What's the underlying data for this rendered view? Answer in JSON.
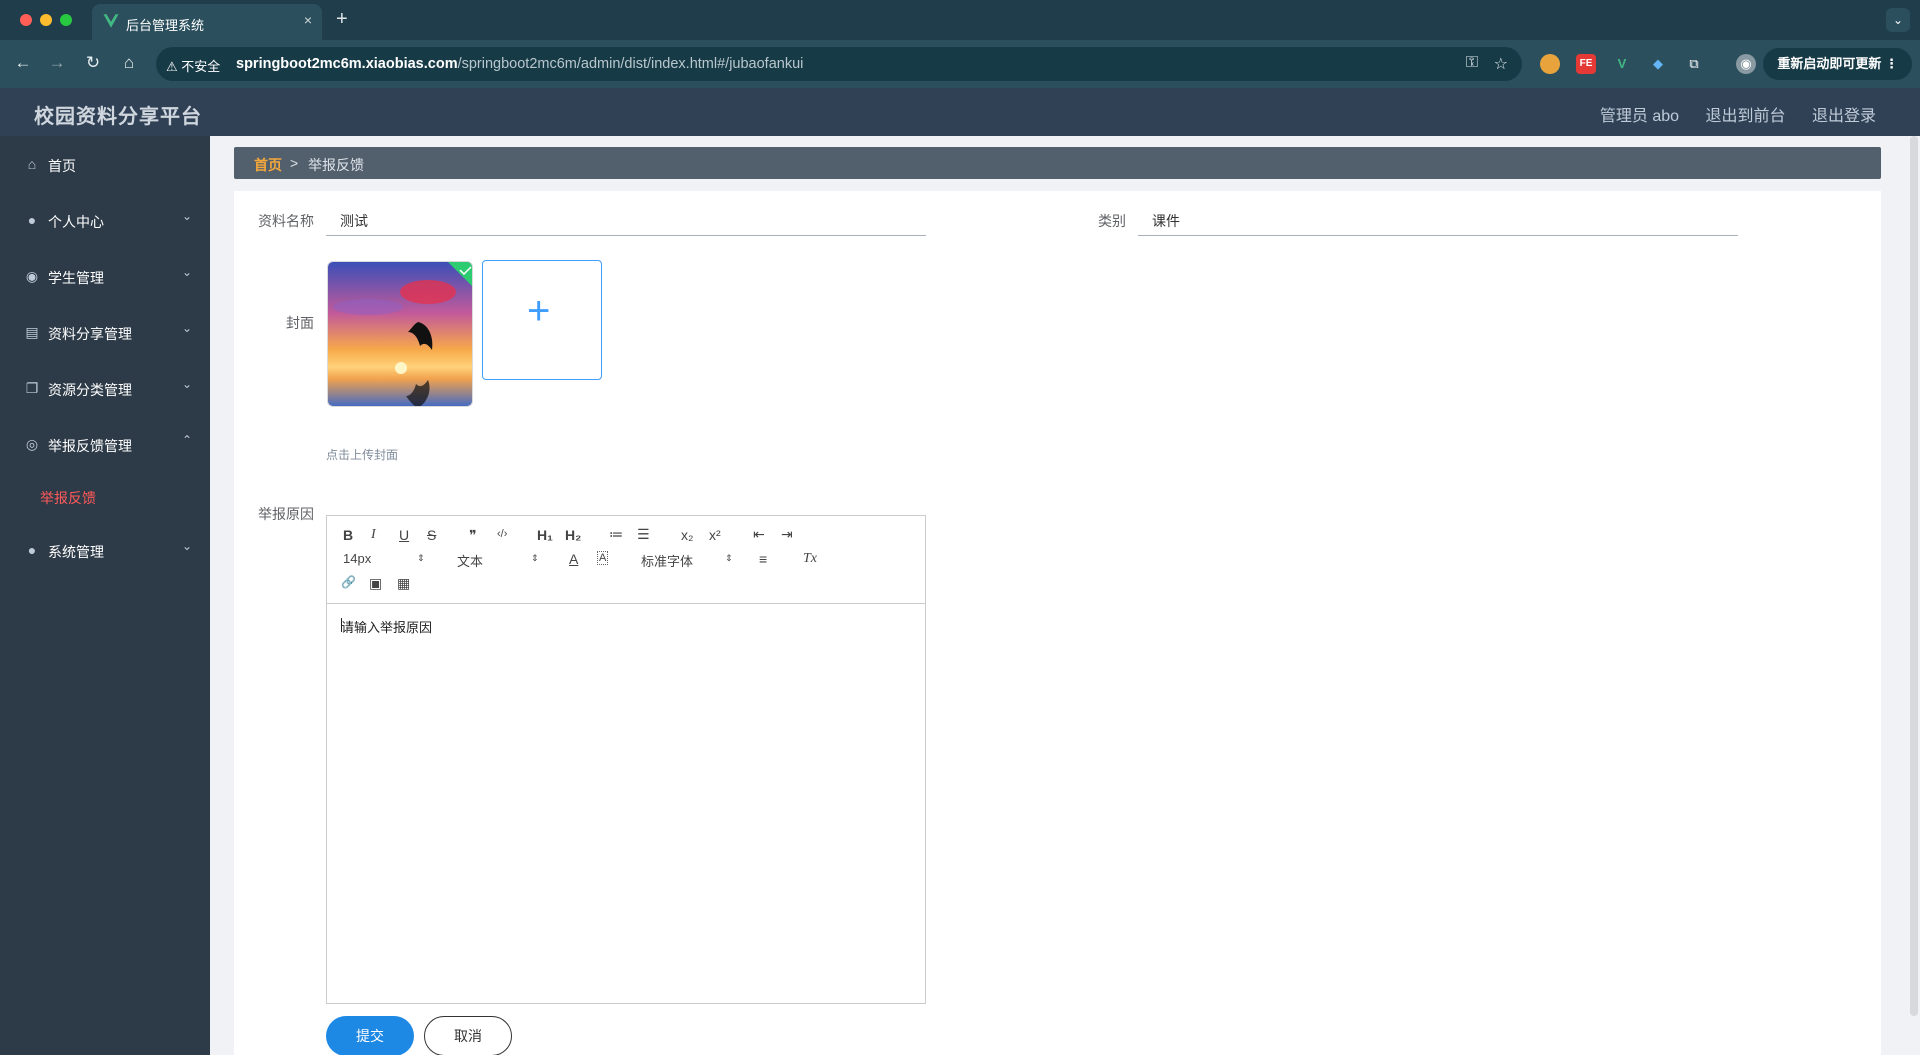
{
  "browser": {
    "tab_title": "后台管理系统",
    "close_glyph": "×",
    "new_tab_glyph": "+",
    "tab_menu_glyph": "⌄",
    "insecure_label": "⚠ 不安全",
    "url_host": "springboot2mc6m.xiaobias.com",
    "url_path": "/springboot2mc6m/admin/dist/index.html#/jubaofankui",
    "update_label": "重新启动即可更新",
    "nav": {
      "back": "←",
      "forward": "→",
      "reload": "↻",
      "home": "⌂"
    },
    "omni_icons": {
      "key": "⚿",
      "star": "☆"
    },
    "ext_labels": {
      "fe": "FE",
      "v": "V",
      "puzzle": "⧉",
      "profile": "◉"
    },
    "colors": {
      "tabbar": "#1f3d4a",
      "toolbar": "#2b4f5c"
    }
  },
  "app": {
    "title": "校园资料分享平台",
    "admin_label": "管理员 abo",
    "front_link": "退出到前台",
    "logout_link": "退出登录"
  },
  "sidebar": {
    "items": [
      {
        "label": "首页",
        "icon": "home-icon",
        "glyph": "⌂",
        "arrow": ""
      },
      {
        "label": "个人中心",
        "icon": "user-icon",
        "glyph": "●",
        "arrow": "⌄"
      },
      {
        "label": "学生管理",
        "icon": "pin-icon",
        "glyph": "◉",
        "arrow": "⌄"
      },
      {
        "label": "资料分享管理",
        "icon": "chat-icon",
        "glyph": "▤",
        "arrow": "⌄"
      },
      {
        "label": "资源分类管理",
        "icon": "copy-icon",
        "glyph": "❐",
        "arrow": "⌄"
      },
      {
        "label": "举报反馈管理",
        "icon": "help-icon",
        "glyph": "◎",
        "arrow": "⌃"
      },
      {
        "label": "系统管理",
        "icon": "user-icon",
        "glyph": "●",
        "arrow": "⌄"
      }
    ],
    "active_sub": "举报反馈",
    "active_color": "#ff5a5a"
  },
  "breadcrumb": {
    "home": "首页",
    "separator": ">",
    "current": "举报反馈"
  },
  "form": {
    "name_label": "资料名称",
    "name_value": "测试",
    "category_label": "类别",
    "category_value": "课件",
    "cover_label": "封面",
    "upload_plus": "+",
    "upload_tip": "点击上传封面",
    "reason_label": "举报原因",
    "reason_placeholder": "请输入举报原因",
    "submit_label": "提交",
    "cancel_label": "取消"
  },
  "editor_toolbar": {
    "bold": "B",
    "italic": "I",
    "underline": "U",
    "strike": "S",
    "quote": "❞",
    "code": "‹/›",
    "h1": "H₁",
    "h2": "H₂",
    "ol": "≔",
    "ul": "☰",
    "sub": "x₂",
    "sup": "x²",
    "outdent": "⇤",
    "indent": "⇥",
    "size": "14px",
    "header": "文本",
    "font": "标准字体",
    "color": "A",
    "background": "A",
    "align": "≡",
    "clean": "Tx",
    "link": "🔗",
    "image": "▣",
    "video": "▦",
    "caret": "⇕"
  }
}
